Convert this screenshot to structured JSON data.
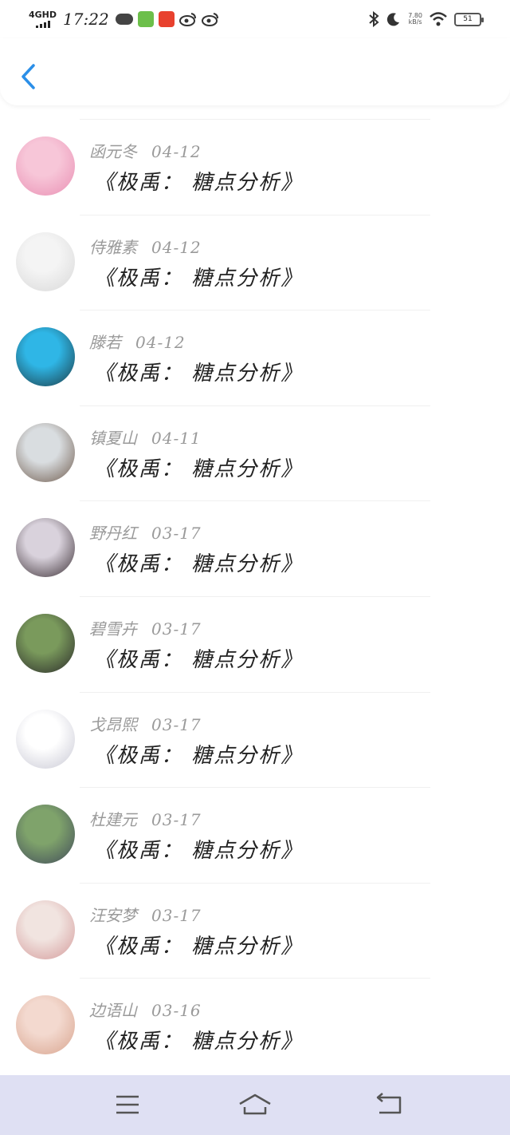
{
  "status_bar": {
    "network": "4GHD",
    "time": "17:22",
    "speed_value": "7.80",
    "speed_unit": "kB/s",
    "battery": "51"
  },
  "header": {
    "back_icon": "chevron-left-icon",
    "accent_color": "#2b8fe8"
  },
  "comments": [
    {
      "name": "函元冬",
      "date": "04-12",
      "text": "《极禹： 糖点分析》",
      "avatar_colors": [
        "#f7c6d8",
        "#e98fb3"
      ]
    },
    {
      "name": "侍雅素",
      "date": "04-12",
      "text": "《极禹： 糖点分析》",
      "avatar_colors": [
        "#f4f4f4",
        "#d8d8d8"
      ]
    },
    {
      "name": "滕若",
      "date": "04-12",
      "text": "《极禹： 糖点分析》",
      "avatar_colors": [
        "#2fb6e6",
        "#1b3a44"
      ]
    },
    {
      "name": "镇夏山",
      "date": "04-11",
      "text": "《极禹： 糖点分析》",
      "avatar_colors": [
        "#d9dde0",
        "#6e5a4c"
      ]
    },
    {
      "name": "野丹红",
      "date": "03-17",
      "text": "《极禹： 糖点分析》",
      "avatar_colors": [
        "#d9d2dc",
        "#3a2e34"
      ]
    },
    {
      "name": "碧雪卉",
      "date": "03-17",
      "text": "《极禹： 糖点分析》",
      "avatar_colors": [
        "#7a9a5c",
        "#2a2a2a"
      ]
    },
    {
      "name": "戈昂熙",
      "date": "03-17",
      "text": "《极禹： 糖点分析》",
      "avatar_colors": [
        "#ffffff",
        "#c8c8d4"
      ]
    },
    {
      "name": "杜建元",
      "date": "03-17",
      "text": "《极禹： 糖点分析》",
      "avatar_colors": [
        "#7fa36b",
        "#404a5a"
      ]
    },
    {
      "name": "汪安梦",
      "date": "03-17",
      "text": "《极禹： 糖点分析》",
      "avatar_colors": [
        "#f1e4e0",
        "#d49a9a"
      ]
    },
    {
      "name": "边语山",
      "date": "03-16",
      "text": "《极禹： 糖点分析》",
      "avatar_colors": [
        "#f3d9cf",
        "#d8a48e"
      ]
    }
  ],
  "nav_bar": {
    "menu_icon": "menu-icon",
    "home_icon": "home-icon",
    "back_icon": "back-icon",
    "background": "#dfe0f3"
  }
}
